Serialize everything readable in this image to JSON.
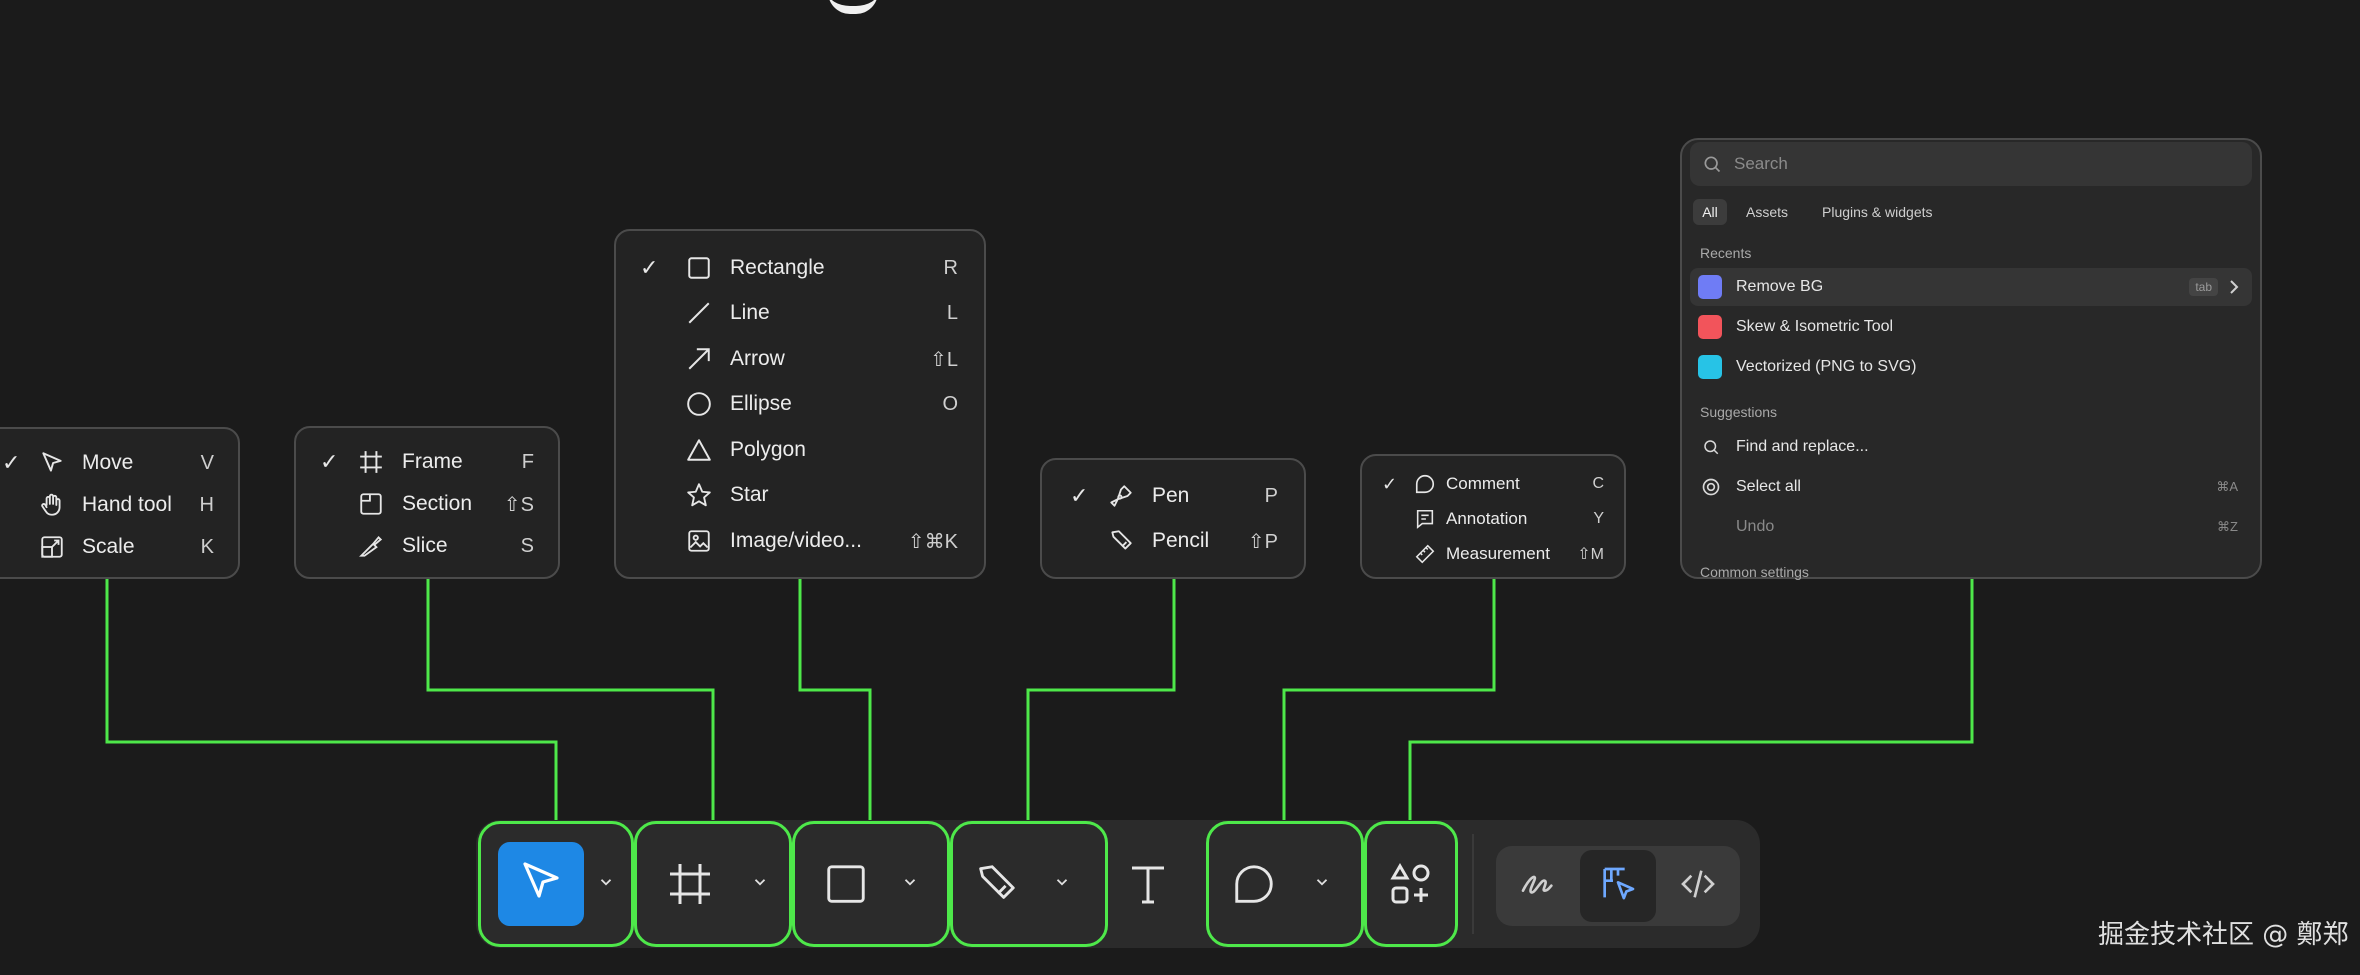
{
  "menus": {
    "move": {
      "items": [
        {
          "check": "✓",
          "label": "Move",
          "shortcut": "V",
          "icon": "cursor-icon"
        },
        {
          "check": "",
          "label": "Hand tool",
          "shortcut": "H",
          "icon": "hand-icon"
        },
        {
          "check": "",
          "label": "Scale",
          "shortcut": "K",
          "icon": "scale-icon"
        }
      ]
    },
    "frame": {
      "items": [
        {
          "check": "✓",
          "label": "Frame",
          "shortcut": "F",
          "icon": "frame-icon"
        },
        {
          "check": "",
          "label": "Section",
          "shortcut": "⇧S",
          "icon": "section-icon"
        },
        {
          "check": "",
          "label": "Slice",
          "shortcut": "S",
          "icon": "slice-icon"
        }
      ]
    },
    "shape": {
      "items": [
        {
          "check": "✓",
          "label": "Rectangle",
          "shortcut": "R",
          "icon": "rectangle-icon"
        },
        {
          "check": "",
          "label": "Line",
          "shortcut": "L",
          "icon": "line-icon"
        },
        {
          "check": "",
          "label": "Arrow",
          "shortcut": "⇧L",
          "icon": "arrow-icon"
        },
        {
          "check": "",
          "label": "Ellipse",
          "shortcut": "O",
          "icon": "ellipse-icon"
        },
        {
          "check": "",
          "label": "Polygon",
          "shortcut": "",
          "icon": "polygon-icon"
        },
        {
          "check": "",
          "label": "Star",
          "shortcut": "",
          "icon": "star-icon"
        },
        {
          "check": "",
          "label": "Image/video...",
          "shortcut": "⇧⌘K",
          "icon": "image-icon"
        }
      ]
    },
    "pen": {
      "items": [
        {
          "check": "✓",
          "label": "Pen",
          "shortcut": "P",
          "icon": "pen-icon"
        },
        {
          "check": "",
          "label": "Pencil",
          "shortcut": "⇧P",
          "icon": "pencil-icon"
        }
      ]
    },
    "comment": {
      "items": [
        {
          "check": "✓",
          "label": "Comment",
          "shortcut": "C",
          "icon": "comment-icon"
        },
        {
          "check": "",
          "label": "Annotation",
          "shortcut": "Y",
          "icon": "annotation-icon"
        },
        {
          "check": "",
          "label": "Measurement",
          "shortcut": "⇧M",
          "icon": "measure-icon"
        }
      ]
    }
  },
  "actions_panel": {
    "search_placeholder": "Search",
    "tabs": [
      "All",
      "Assets",
      "Plugins & widgets"
    ],
    "recents_title": "Recents",
    "recents": [
      {
        "label": "Remove BG",
        "badge": "tab",
        "color": "#6f7cf5"
      },
      {
        "label": "Skew & Isometric Tool",
        "badge": "",
        "color": "#f2545b"
      },
      {
        "label": "Vectorized (PNG to SVG)",
        "badge": "",
        "color": "#27c3e6"
      }
    ],
    "suggestions_title": "Suggestions",
    "suggestions": [
      {
        "label": "Find and replace...",
        "shortcut": "",
        "icon": "search-icon"
      },
      {
        "label": "Select all",
        "shortcut": "⌘A",
        "icon": "select-all-icon"
      },
      {
        "label": "Undo",
        "shortcut": "⌘Z",
        "icon": ""
      }
    ],
    "common_settings_title": "Common settings"
  },
  "toolbar": {
    "accent": "#1e88e5",
    "outline": "#4ee84a",
    "tools": [
      "move-tool",
      "frame-tool",
      "shape-tool",
      "pen-tool",
      "text-tool",
      "comment-tool",
      "actions-tool"
    ],
    "modes": [
      "draw-mode",
      "design-mode",
      "dev-mode"
    ]
  },
  "watermark": "掘金技术社区 @ 鄭郑"
}
